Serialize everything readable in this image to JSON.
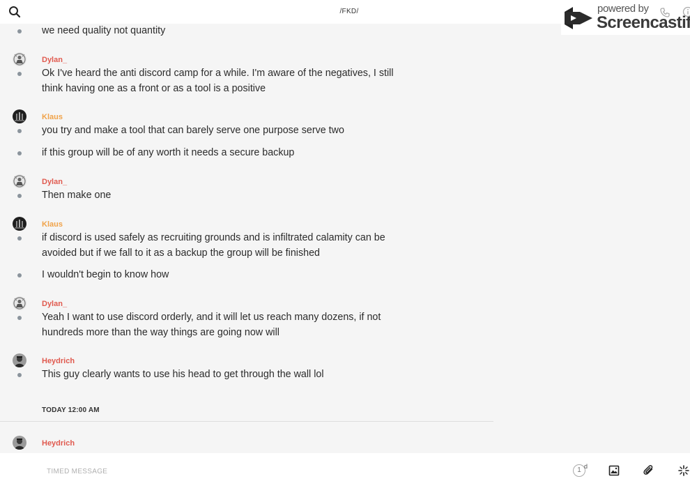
{
  "header": {
    "channel_title": "/FKD/",
    "watermark_powered": "powered by",
    "watermark_brand": "Screencastify"
  },
  "messages": [
    {
      "author": "",
      "text": "we need quality not quantity"
    },
    {
      "author": "Dylan_",
      "text": "Ok I've heard the anti discord camp for a while. I'm aware of the negatives, I still think having one as a front or as a tool is a positive"
    },
    {
      "author": "Klaus",
      "text": "you try and make a tool that can barely serve one purpose serve two"
    },
    {
      "author": "",
      "text": "if this group will be of any worth it needs a secure backup"
    },
    {
      "author": "Dylan_",
      "text": "Then make one"
    },
    {
      "author": "Klaus",
      "text": "if discord is used safely as recruiting grounds and is infiltrated calamity can be avoided but if we fall to it as a backup the group will be finished"
    },
    {
      "author": "",
      "text": "I wouldn't begin to know how"
    },
    {
      "author": "Dylan_",
      "text": "Yeah I want to use discord orderly, and it will let us reach many dozens, if not hundreds more than the way things are going now will"
    },
    {
      "author": "Heydrich",
      "text": "This guy clearly wants to use his head to get through the wall lol"
    },
    {
      "author": "Heydrich",
      "text": ""
    }
  ],
  "date_divider": "TODAY 12:00 AM",
  "composer": {
    "placeholder": "TIMED MESSAGE",
    "timer_value": "1",
    "timer_unit": "d"
  },
  "icons": {
    "search": "search-icon",
    "call": "phone-icon",
    "info": "info-icon",
    "image": "image-icon",
    "attach": "paperclip-icon",
    "more": "sparkle-icon"
  },
  "colors": {
    "author_red": "#e05a4f",
    "author_orange": "#f0a34a",
    "bullet": "#8b949c",
    "background": "#f5f5f5"
  }
}
